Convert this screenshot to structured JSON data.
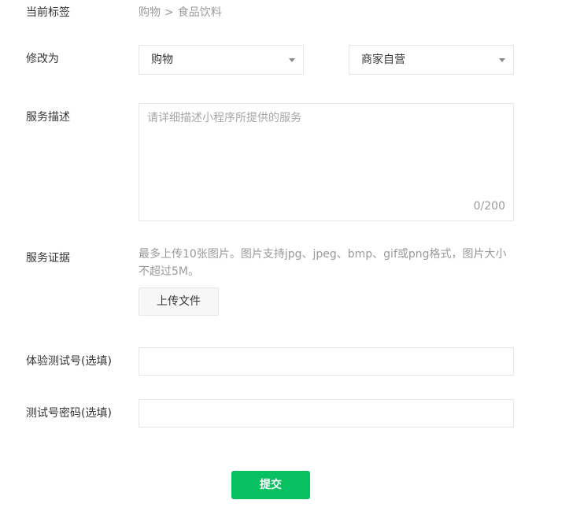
{
  "current_tag": {
    "label": "当前标签",
    "category": "购物",
    "separator": ">",
    "subcategory": "食品饮料"
  },
  "modify_to": {
    "label": "修改为",
    "primary_select": {
      "value": "购物",
      "icon": "caret-down-icon"
    },
    "secondary_select": {
      "value": "商家自营",
      "icon": "caret-down-icon"
    }
  },
  "service_description": {
    "label": "服务描述",
    "value": "",
    "placeholder": "请详细描述小程序所提供的服务",
    "counter": "0/200"
  },
  "service_proof": {
    "label": "服务证据",
    "tip": "最多上传10张图片。图片支持jpg、jpeg、bmp、gif或png格式，图片大小不超过5M。",
    "upload_label": "上传文件"
  },
  "test_account": {
    "label": "体验测试号(选填)",
    "value": "",
    "placeholder": ""
  },
  "test_password": {
    "label": "测试号密码(选填)",
    "value": "",
    "placeholder": ""
  },
  "submit": {
    "label": "提交",
    "color": "#07c160"
  }
}
